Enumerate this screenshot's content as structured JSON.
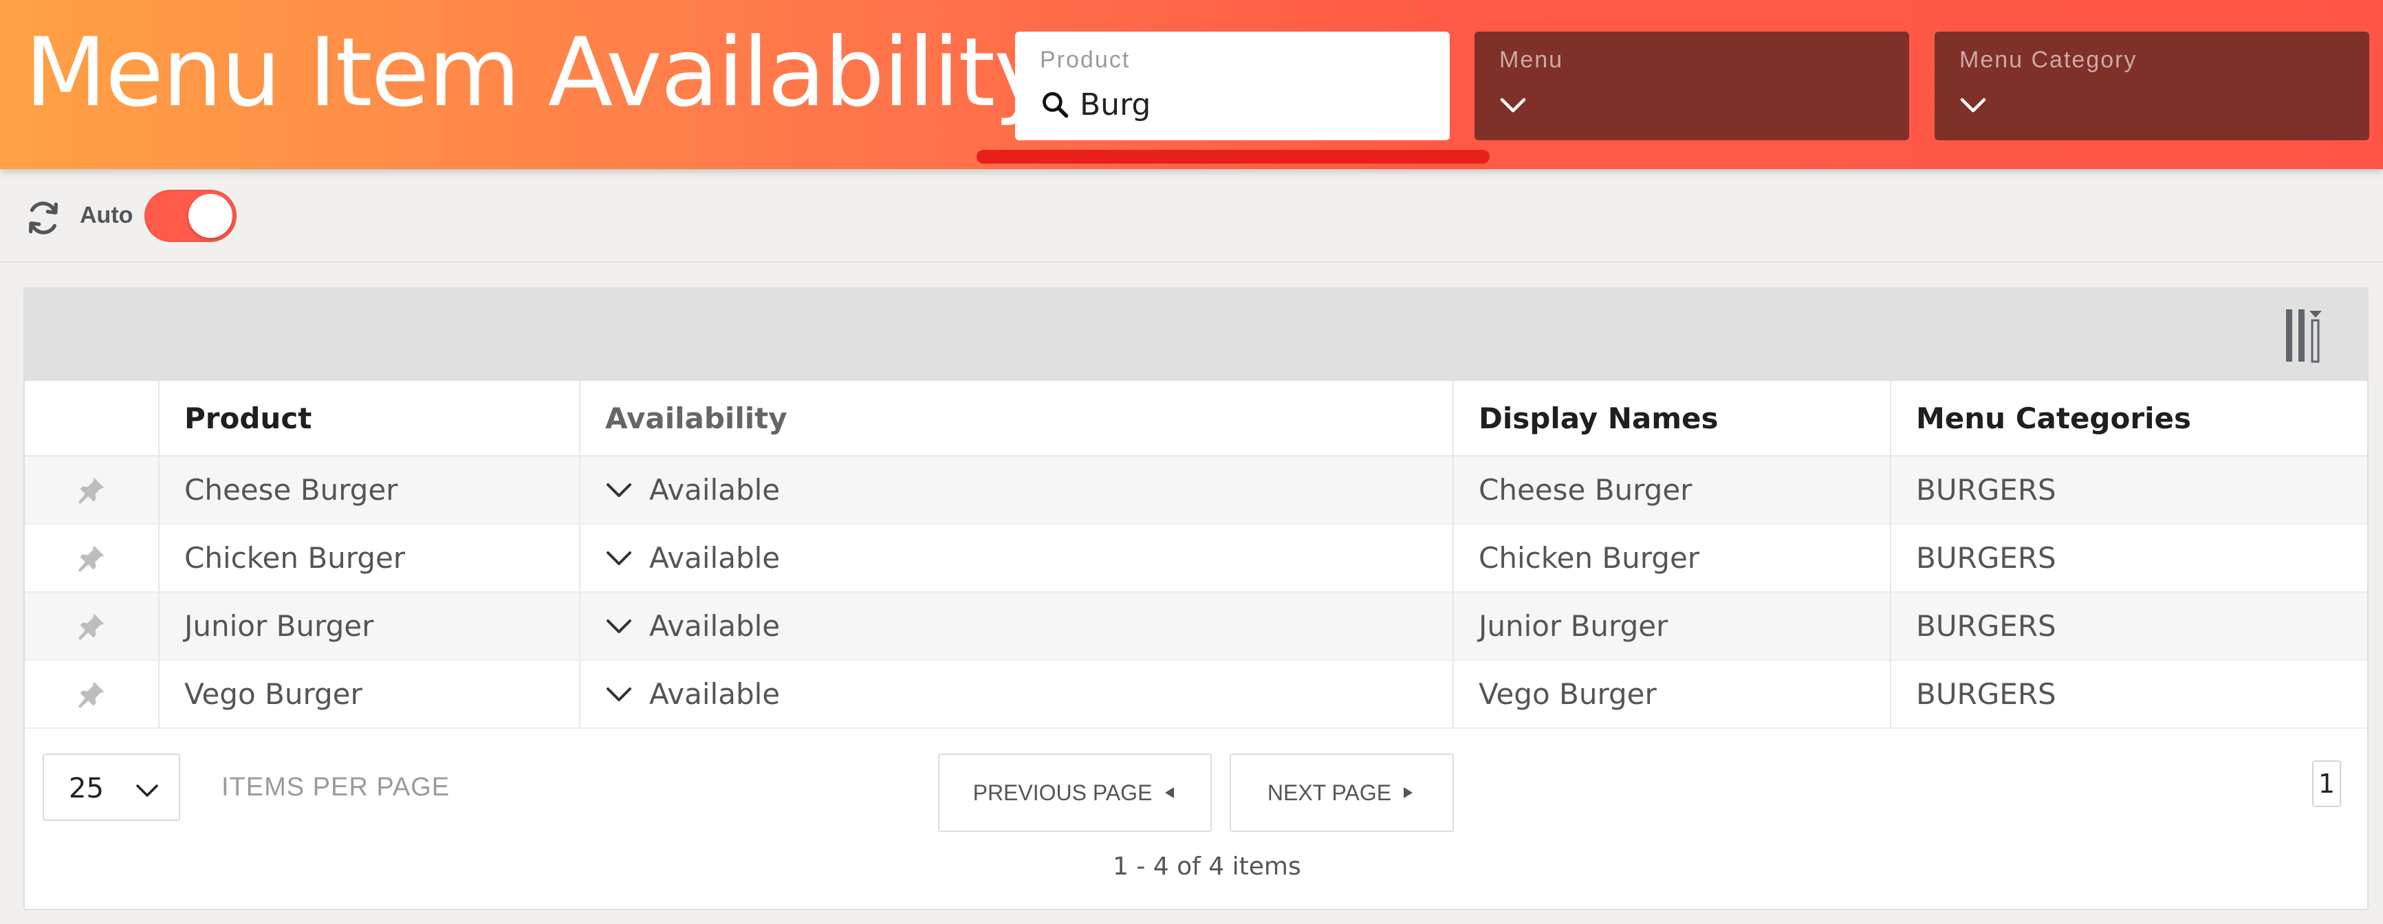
{
  "header": {
    "title": "Menu Item Availability",
    "filters": {
      "product": {
        "label": "Product",
        "value": "Burg"
      },
      "menu": {
        "label": "Menu"
      },
      "category": {
        "label": "Menu Category"
      }
    }
  },
  "toolbar": {
    "auto_label": "Auto",
    "auto_enabled": true
  },
  "table": {
    "columns": [
      "Product",
      "Availability",
      "Display Names",
      "Menu Categories"
    ],
    "rows": [
      {
        "product": "Cheese Burger",
        "availability": "Available",
        "display_name": "Cheese Burger",
        "category": "BURGERS"
      },
      {
        "product": "Chicken Burger",
        "availability": "Available",
        "display_name": "Chicken Burger",
        "category": "BURGERS"
      },
      {
        "product": "Junior Burger",
        "availability": "Available",
        "display_name": "Junior Burger",
        "category": "BURGERS"
      },
      {
        "product": "Vego Burger",
        "availability": "Available",
        "display_name": "Vego Burger",
        "category": "BURGERS"
      }
    ]
  },
  "pager": {
    "page_size": "25",
    "items_per_page_label": "ITEMS PER PAGE",
    "previous_label": "PREVIOUS PAGE",
    "next_label": "NEXT PAGE",
    "current_page": "1",
    "summary": "1 - 4 of 4 items"
  },
  "colors": {
    "header_start": "#ffa144",
    "header_end": "#ff5546",
    "filter_dark": "#7e3029",
    "toggle_on": "#ff5a4a",
    "highlight_underline": "#e8201c"
  },
  "icons": [
    "search-icon",
    "chevron-down-icon",
    "refresh-icon",
    "columns-icon",
    "pin-icon",
    "triangle-left-icon",
    "triangle-right-icon"
  ]
}
